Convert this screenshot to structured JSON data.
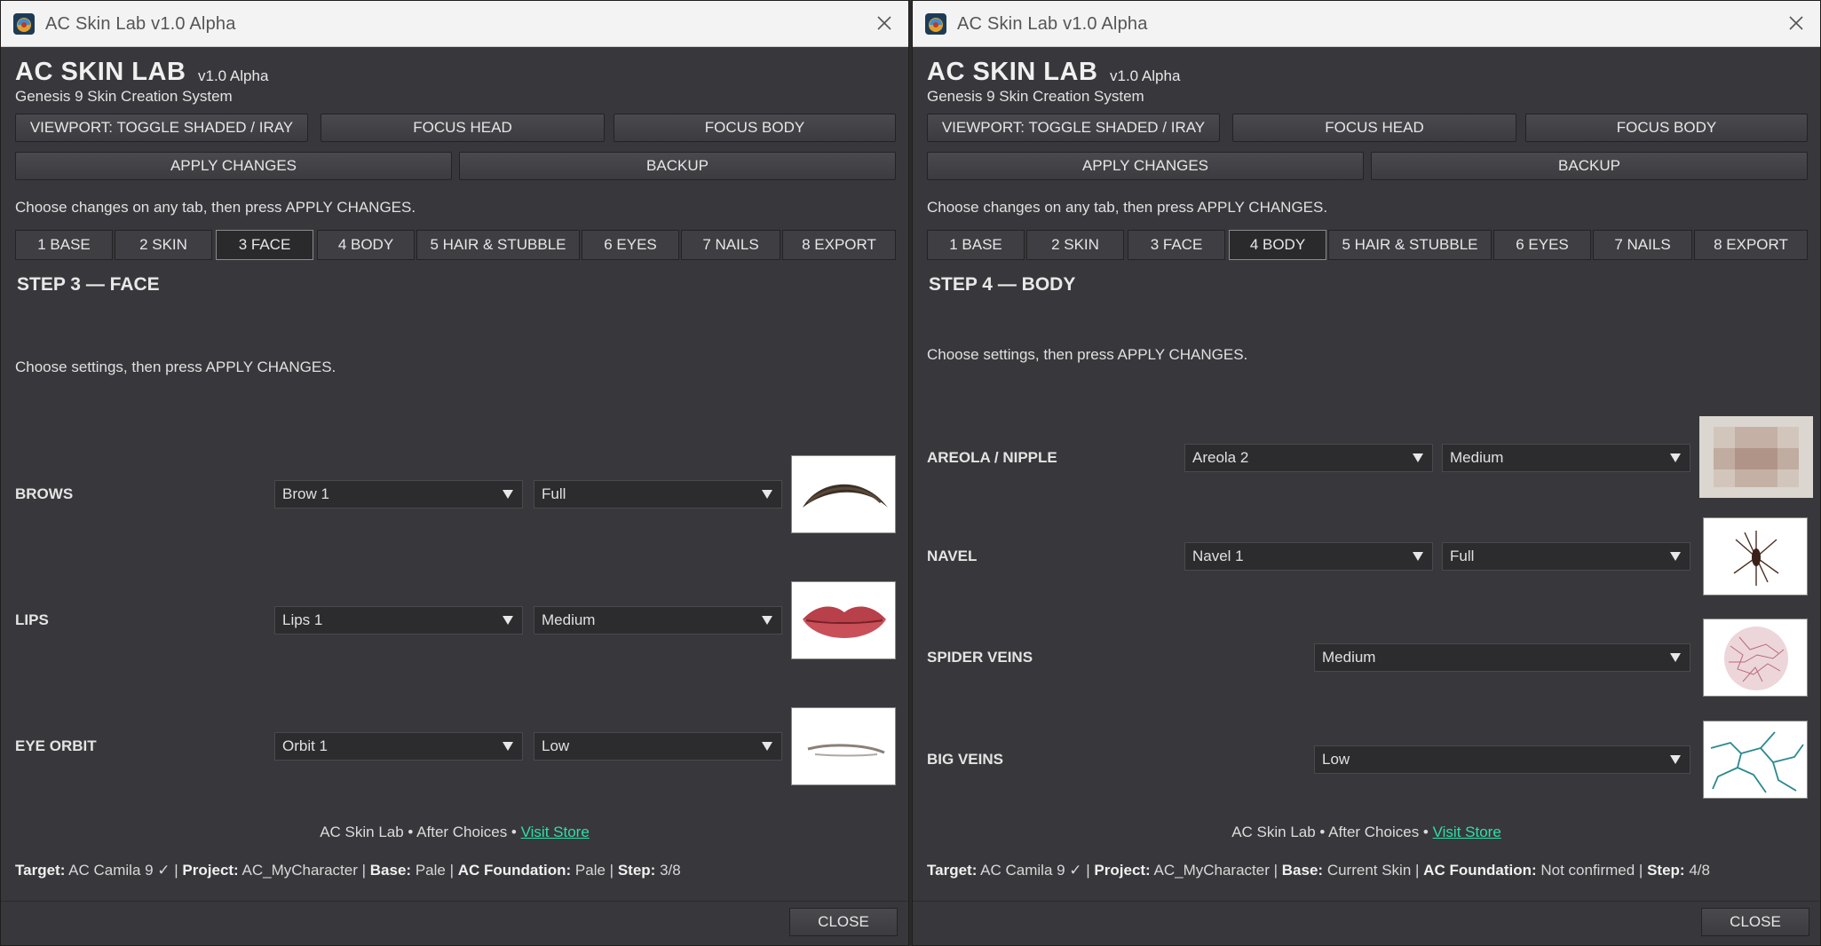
{
  "left": {
    "window_title": "AC Skin Lab v1.0 Alpha",
    "app_name": "AC SKIN LAB",
    "app_version": "v1.0 Alpha",
    "app_subtitle": "Genesis 9 Skin Creation System",
    "toolbar": {
      "viewport": "VIEWPORT: TOGGLE SHADED / IRAY",
      "focus_head": "FOCUS HEAD",
      "focus_body": "FOCUS BODY",
      "apply": "APPLY CHANGES",
      "backup": "BACKUP"
    },
    "hint": "Choose changes on any tab, then press APPLY CHANGES.",
    "tabs": [
      "1 BASE",
      "2 SKIN",
      "3 FACE",
      "4 BODY",
      "5 HAIR & STUBBLE",
      "6 EYES",
      "7 NAILS",
      "8 EXPORT"
    ],
    "active_tab": "3 FACE",
    "step_title": "STEP 3 — FACE",
    "instruction": "Choose settings, then press APPLY CHANGES.",
    "rows": [
      {
        "label": "BROWS",
        "choice": "Brow 1",
        "level": "Full",
        "swatch": "brow-swatch"
      },
      {
        "label": "LIPS",
        "choice": "Lips 1",
        "level": "Medium",
        "swatch": "lips-swatch"
      },
      {
        "label": "EYE ORBIT",
        "choice": "Orbit 1",
        "level": "Low",
        "swatch": "orbit-swatch"
      }
    ],
    "footer": {
      "credit": "AC Skin Lab • After Choices • ",
      "link": "Visit Store"
    },
    "status": {
      "target_label": "Target:",
      "target_value": "AC Camila 9 ✓",
      "project_label": "Project:",
      "project_value": "AC_MyCharacter",
      "base_label": "Base:",
      "base_value": "Pale",
      "foundation_label": "AC Foundation:",
      "foundation_value": "Pale",
      "step_label": "Step:",
      "step_value": "3/8"
    },
    "close": "CLOSE"
  },
  "right": {
    "window_title": "AC Skin Lab v1.0 Alpha",
    "app_name": "AC SKIN LAB",
    "app_version": "v1.0 Alpha",
    "app_subtitle": "Genesis 9 Skin Creation System",
    "toolbar": {
      "viewport": "VIEWPORT: TOGGLE SHADED / IRAY",
      "focus_head": "FOCUS HEAD",
      "focus_body": "FOCUS BODY",
      "apply": "APPLY CHANGES",
      "backup": "BACKUP"
    },
    "hint": "Choose changes on any tab, then press APPLY CHANGES.",
    "tabs": [
      "1 BASE",
      "2 SKIN",
      "3 FACE",
      "4 BODY",
      "5 HAIR & STUBBLE",
      "6 EYES",
      "7 NAILS",
      "8 EXPORT"
    ],
    "active_tab": "4 BODY",
    "step_title": "STEP 4 — BODY",
    "instruction": "Choose settings, then press APPLY CHANGES.",
    "rows": [
      {
        "label": "AREOLA / NIPPLE",
        "choice": "Areola 2",
        "level": "Medium",
        "swatch": "areola-swatch"
      },
      {
        "label": "NAVEL",
        "choice": "Navel 1",
        "level": "Full",
        "swatch": "navel-swatch"
      },
      {
        "label": "SPIDER VEINS",
        "level": "Medium",
        "swatch": "spider-veins-swatch"
      },
      {
        "label": "BIG VEINS",
        "level": "Low",
        "swatch": "big-veins-swatch"
      }
    ],
    "footer": {
      "credit": "AC Skin Lab • After Choices • ",
      "link": "Visit Store"
    },
    "status": {
      "target_label": "Target:",
      "target_value": "AC Camila 9 ✓",
      "project_label": "Project:",
      "project_value": "AC_MyCharacter",
      "base_label": "Base:",
      "base_value": "Current Skin",
      "foundation_label": "AC Foundation:",
      "foundation_value": "Not confirmed",
      "step_label": "Step:",
      "step_value": "4/8"
    },
    "close": "CLOSE"
  },
  "icons": {
    "app": "app-logo-icon",
    "close": "close-icon",
    "dropdown": "chevron-down-icon"
  },
  "colors": {
    "window_bg": "#38383c",
    "link": "#2ee0a6",
    "titlebar": "#f3f3f3"
  }
}
